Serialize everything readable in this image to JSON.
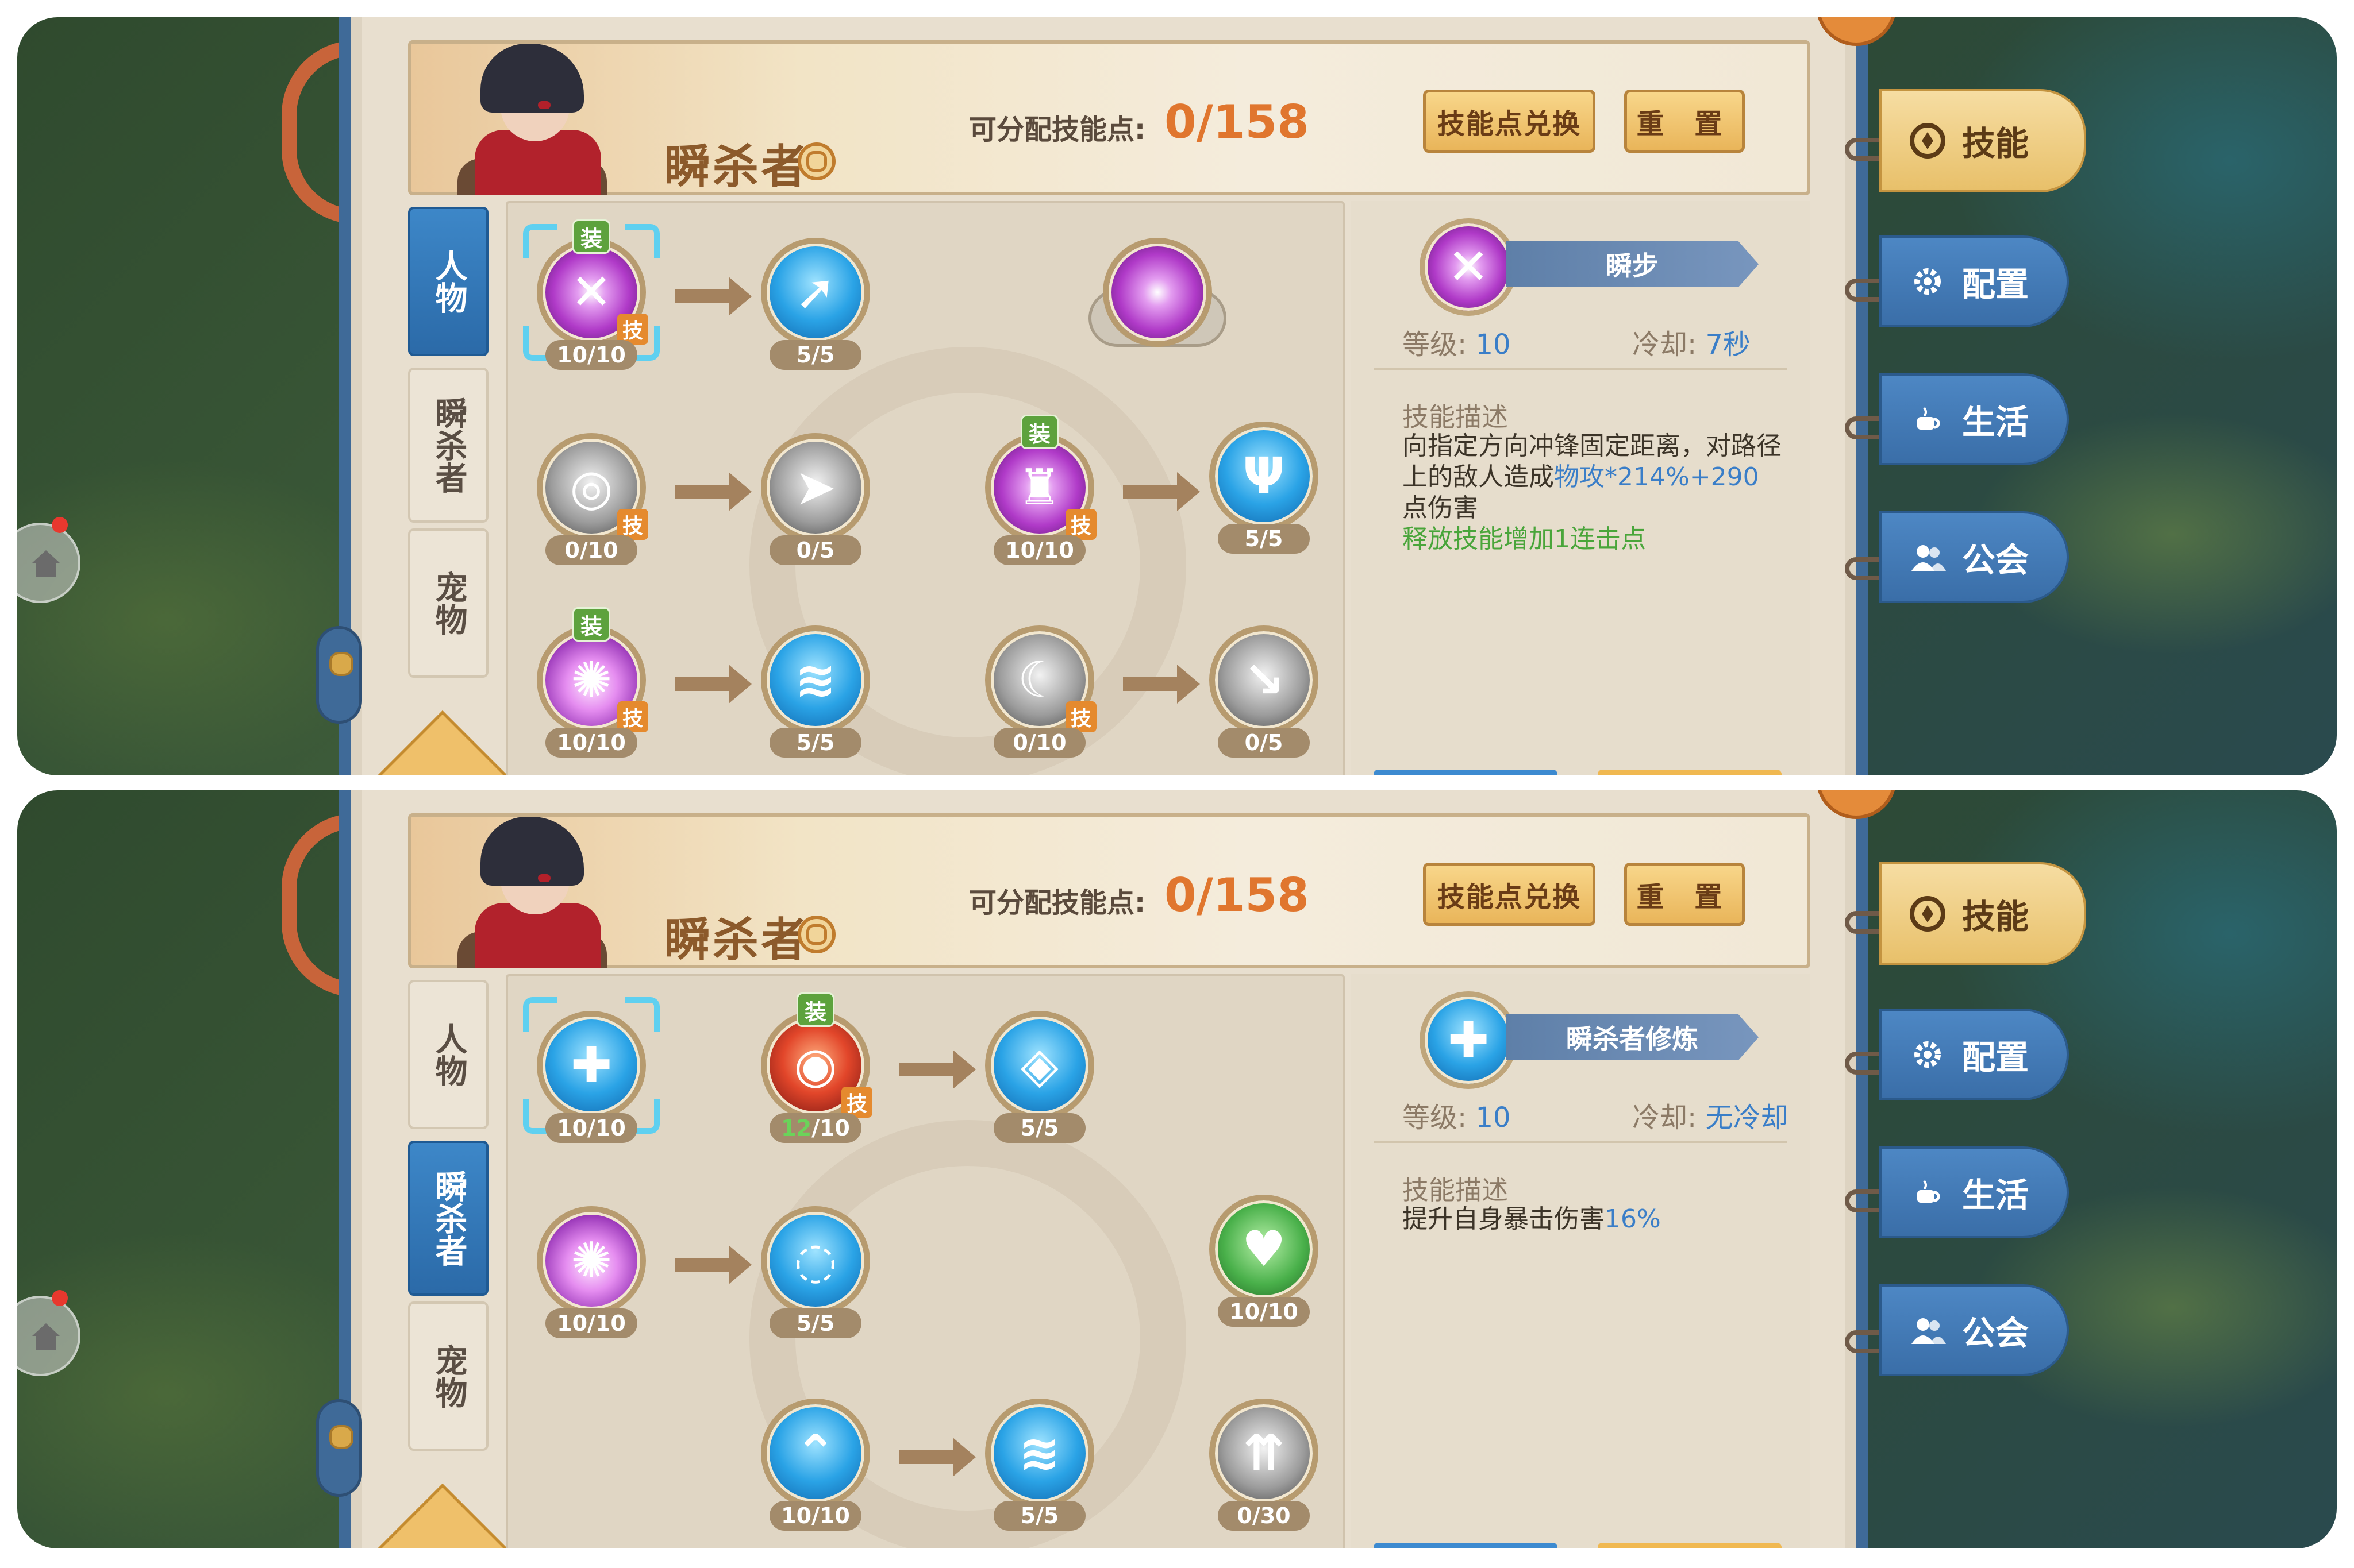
{
  "header": {
    "class_name": "瞬杀者",
    "points_label": "可分配技能点:",
    "points_value": "0/158",
    "exchange_button": "技能点兑换",
    "reset_button": "重 置"
  },
  "side_tabs": [
    "人物",
    "瞬杀者",
    "宠物"
  ],
  "right_tabs": [
    {
      "label": "技能",
      "icon": "skill-icon"
    },
    {
      "label": "配置",
      "icon": "gear-icon"
    },
    {
      "label": "生活",
      "icon": "cup-icon"
    },
    {
      "label": "公会",
      "icon": "people-icon"
    }
  ],
  "badges": {
    "equipped": "装",
    "skill": "技"
  },
  "panel1": {
    "active_tab": "人物",
    "nodes": [
      {
        "id": "n1",
        "level": "10/10",
        "icon": "purple-slash-icon",
        "equipped": true,
        "skill": true,
        "selected": true
      },
      {
        "id": "n2",
        "level": "5/5",
        "icon": "speed-boot-icon"
      },
      {
        "id": "n3",
        "level": "",
        "icon": "purple-winged-orb-icon"
      },
      {
        "id": "n4",
        "level": "0/10",
        "icon": "whirlwind-icon",
        "skill": true
      },
      {
        "id": "n5",
        "level": "0/5",
        "icon": "cursor-plus-icon"
      },
      {
        "id": "n6",
        "level": "10/10",
        "icon": "shadow-figure-icon",
        "equipped": true,
        "skill": true
      },
      {
        "id": "n7",
        "level": "5/5",
        "icon": "trident-icon"
      },
      {
        "id": "n8",
        "level": "10/10",
        "icon": "pink-burst-icon",
        "equipped": true,
        "skill": true
      },
      {
        "id": "n9",
        "level": "5/5",
        "icon": "daggers-icon"
      },
      {
        "id": "n10",
        "level": "0/10",
        "icon": "grey-slash-icon",
        "skill": true
      },
      {
        "id": "n11",
        "level": "0/5",
        "icon": "arrow-down-minus-icon"
      }
    ],
    "detail": {
      "name": "瞬步",
      "level_label": "等级:",
      "level_value": "10",
      "cd_label": "冷却:",
      "cd_value": "7秒",
      "desc_title": "技能描述",
      "desc_prefix": "向指定方向冲锋固定距离，对路径上的敌人造成",
      "desc_highlight": "物攻*214%+290",
      "desc_suffix": "点伤害",
      "desc_extra": "释放技能增加1连击点"
    }
  },
  "panel2": {
    "active_tab": "瞬杀者",
    "nodes": [
      {
        "id": "m1",
        "level": "10/10",
        "icon": "blue-flame-icon",
        "selected": true
      },
      {
        "id": "m2",
        "level_current": "12",
        "level_max": "/10",
        "icon": "red-vortex-icon",
        "equipped": true,
        "skill": true
      },
      {
        "id": "m3",
        "level": "5/5",
        "icon": "diamond-icon"
      },
      {
        "id": "m4",
        "level": "10/10",
        "icon": "pink-burst-icon"
      },
      {
        "id": "m5",
        "level": "5/5",
        "icon": "ring-icon"
      },
      {
        "id": "m6",
        "level": "10/10",
        "icon": "heart-plus-icon"
      },
      {
        "id": "m7",
        "level": "10/10",
        "icon": "chevron-plus-icon"
      },
      {
        "id": "m8",
        "level": "5/5",
        "icon": "daggers-icon"
      },
      {
        "id": "m9",
        "level": "0/30",
        "icon": "arrows-up-icon"
      }
    ],
    "detail": {
      "name": "瞬杀者修炼",
      "level_label": "等级:",
      "level_value": "10",
      "cd_label": "冷却:",
      "cd_value": "无冷却",
      "desc_title": "技能描述",
      "desc_prefix": "提升自身暴击伤害",
      "desc_highlight": "16%"
    }
  },
  "colors": {
    "accent_orange": "#e0762e",
    "tab_blue": "#3a6ea8",
    "highlight_blue": "#3a7ec8",
    "highlight_green": "#49a53a"
  }
}
